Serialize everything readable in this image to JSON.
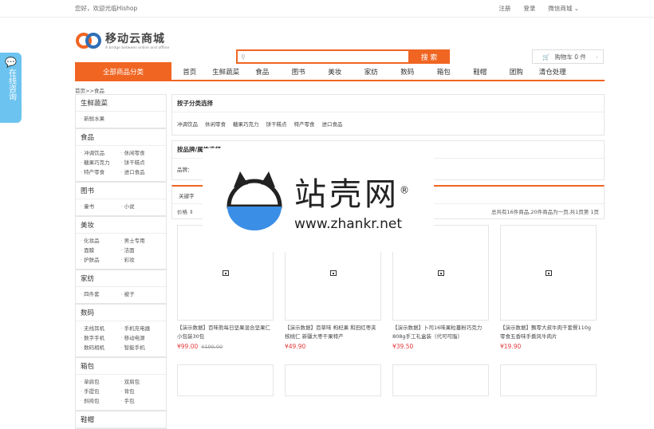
{
  "topbar": {
    "welcome": "您好，欢迎光临Hishop",
    "register": "注册",
    "login": "登录",
    "wechat": "微信商城 ⌄"
  },
  "logo": {
    "name": "移动云商城",
    "tagline": "A bridge between online and offline"
  },
  "search": {
    "placeholder": "",
    "button": "搜 索"
  },
  "cart": {
    "label": "购物车 0 件"
  },
  "nav": {
    "all_categories": "全部商品分类",
    "items": [
      "首页",
      "生鲜蔬菜",
      "食品",
      "图书",
      "美妆",
      "家纺",
      "数码",
      "箱包",
      "鞋帽",
      "团购",
      "清仓处理"
    ]
  },
  "float_consult": {
    "label": "在线咨询"
  },
  "breadcrumb": "首页>>食品",
  "sidebar": [
    {
      "title": "生鲜蔬菜",
      "items": [
        "新鲜水果"
      ]
    },
    {
      "title": "食品",
      "items": [
        "冲调饮品",
        "休闲零食",
        "糖果巧克力",
        "饼干糕点",
        "特产零食",
        "进口食品"
      ]
    },
    {
      "title": "图书",
      "items": [
        "童书",
        "小说"
      ]
    },
    {
      "title": "美妆",
      "items": [
        "化妆品",
        "男士专用",
        "面膜",
        "洁面",
        "护肤品",
        "彩妆"
      ]
    },
    {
      "title": "家纺",
      "items": [
        "四件套",
        "被子"
      ]
    },
    {
      "title": "数码",
      "items": [
        "无线耳机",
        "手机充电器",
        "数字手机",
        "移动电源",
        "数码相机",
        "智能手机"
      ]
    },
    {
      "title": "箱包",
      "items": [
        "单肩包",
        "双肩包",
        "手提包",
        "背包",
        "斜挎包",
        "手包"
      ]
    },
    {
      "title": "鞋帽",
      "items": []
    }
  ],
  "subcategory": {
    "title": "按子分类选择",
    "items": [
      "冲调饮品",
      "休闲零食",
      "糖果巧克力",
      "饼干糕点",
      "特产零食",
      "进口食品"
    ]
  },
  "brand": {
    "title": "按品牌/属性选择",
    "label": "品牌："
  },
  "sort": {
    "keyword": "关键字",
    "price": "价格 ⇕",
    "summary": "总共有16件商品,20件商品为一页,共1页第 1页"
  },
  "products": [
    {
      "name": "【演示数据】百味熊每日坚果混合坚果仁 小包装30包",
      "price": "¥99.00",
      "old_price": "¥199.00"
    },
    {
      "name": "【演示数据】百草味 枸杞果 和田红枣夹核桃仁 新疆大枣干果特产",
      "price": "¥49.90",
      "old_price": ""
    },
    {
      "name": "【演示数据】卜司16味果粒蔓粉巧克力 808g手工礼盒装（代可可脂）",
      "price": "¥39.50",
      "old_price": ""
    },
    {
      "name": "【演示数据】飘零大叔牛肉干套餐110g 零食五香味手撕风牛肉片",
      "price": "¥19.90",
      "old_price": ""
    }
  ],
  "watermark": {
    "cn": "站壳网",
    "reg": "®",
    "url": "www.zhankr.net"
  },
  "colors": {
    "accent": "#f06522",
    "price": "#e4393c",
    "consult": "#6cc3ef"
  }
}
